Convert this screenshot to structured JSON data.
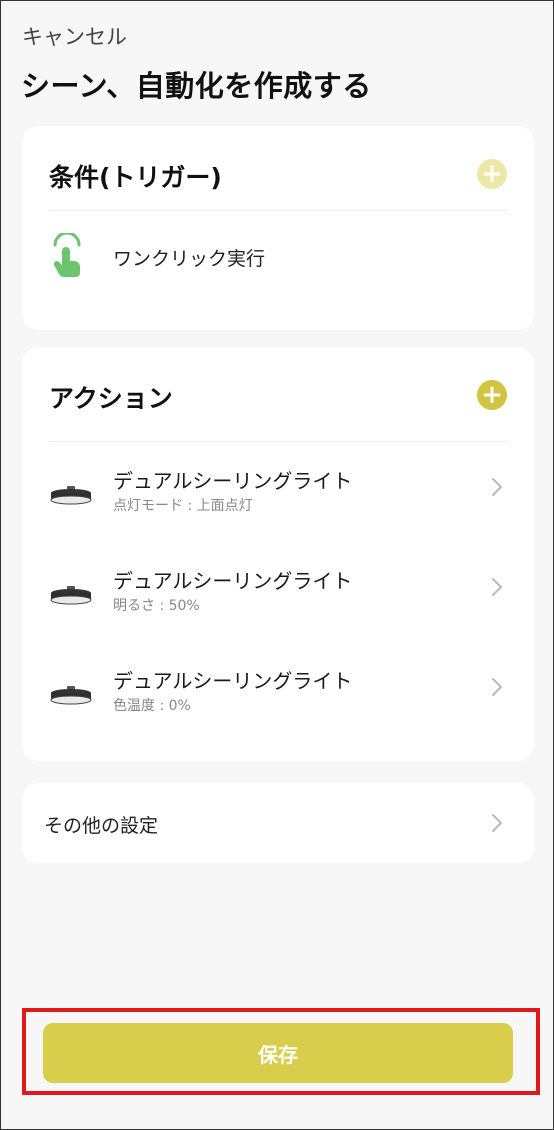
{
  "header": {
    "cancel_label": "キャンセル",
    "title": "シーン、自動化を作成する"
  },
  "conditions": {
    "heading": "条件(トリガー)",
    "add_icon": "plus-circle-icon (disabled, pale yellow)",
    "items": [
      {
        "label": "ワンクリック実行",
        "icon": "tap-hand-icon"
      }
    ]
  },
  "actions": {
    "heading": "アクション",
    "add_icon": "plus-circle-icon",
    "items": [
      {
        "title": "デュアルシーリングライト",
        "detail": "点灯モード : 上面点灯",
        "icon": "ceiling-light-icon"
      },
      {
        "title": "デュアルシーリングライト",
        "detail": "明るさ : 50%",
        "icon": "ceiling-light-icon"
      },
      {
        "title": "デュアルシーリングライト",
        "detail": "色温度 : 0%",
        "icon": "ceiling-light-icon"
      }
    ]
  },
  "other_settings": {
    "label": "その他の設定"
  },
  "footer": {
    "save_label": "保存"
  },
  "colors": {
    "accent": "#d9cd4c",
    "accent_disabled": "#ede8a6",
    "tap_icon_green": "#6cc56e",
    "highlight_border": "#e0191b",
    "background": "#f7f7f7",
    "card": "#ffffff"
  }
}
